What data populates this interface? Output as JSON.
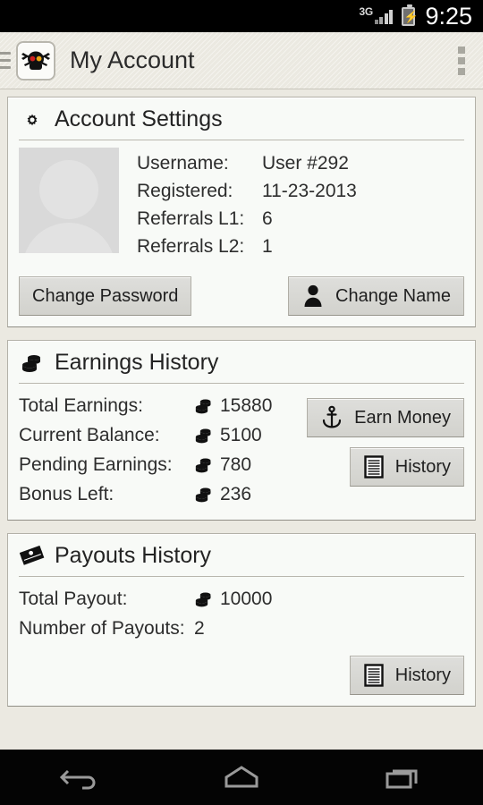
{
  "statusbar": {
    "network": "3G",
    "time": "9:25",
    "battery_icon": "battery-charging-icon",
    "signal_icon": "signal-bars-icon"
  },
  "actionbar": {
    "app_icon": "skull-crossbones-app-icon",
    "title": "My Account",
    "drawer_icon": "hamburger-icon",
    "overflow_icon": "overflow-menu-icon"
  },
  "account_card": {
    "icon": "gear-icon",
    "title": "Account Settings",
    "avatar_icon": "person-placeholder-avatar",
    "fields": [
      {
        "label": "Username:",
        "value": "User #292"
      },
      {
        "label": "Registered:",
        "value": "11-23-2013"
      },
      {
        "label": "Referrals L1:",
        "value": "6"
      },
      {
        "label": "Referrals L2:",
        "value": "1"
      }
    ],
    "change_password_label": "Change Password",
    "change_name_label": "Change Name",
    "change_name_icon": "person-icon"
  },
  "earnings_card": {
    "icon": "coins-icon",
    "title": "Earnings History",
    "rows": [
      {
        "label": "Total Earnings:",
        "value": "15880",
        "coin": true
      },
      {
        "label": "Current Balance:",
        "value": "5100",
        "coin": true
      },
      {
        "label": "Pending Earnings:",
        "value": "780",
        "coin": true
      },
      {
        "label": "Bonus Left:",
        "value": "236",
        "coin": true
      }
    ],
    "earn_money_label": "Earn Money",
    "earn_money_icon": "anchor-icon",
    "history_label": "History",
    "history_icon": "list-document-icon"
  },
  "payouts_card": {
    "icon": "banknotes-icon",
    "title": "Payouts History",
    "rows": [
      {
        "label": "Total Payout:",
        "value": "10000",
        "coin": true
      },
      {
        "label": "Number of Payouts:",
        "value": "2",
        "coin": false
      }
    ],
    "history_label": "History",
    "history_icon": "list-document-icon"
  },
  "navbar": {
    "back_icon": "back-arrow-icon",
    "home_icon": "home-icon",
    "recents_icon": "recents-icon"
  },
  "colors": {
    "page_background": "#ebe9e1",
    "card_background": "#f8faf7",
    "card_border": "#b3b1a8",
    "actionbar": "#e8e6de",
    "text_primary": "#2d2d2d",
    "button_face": "#d6d6d1",
    "statusbar": "#000000"
  }
}
